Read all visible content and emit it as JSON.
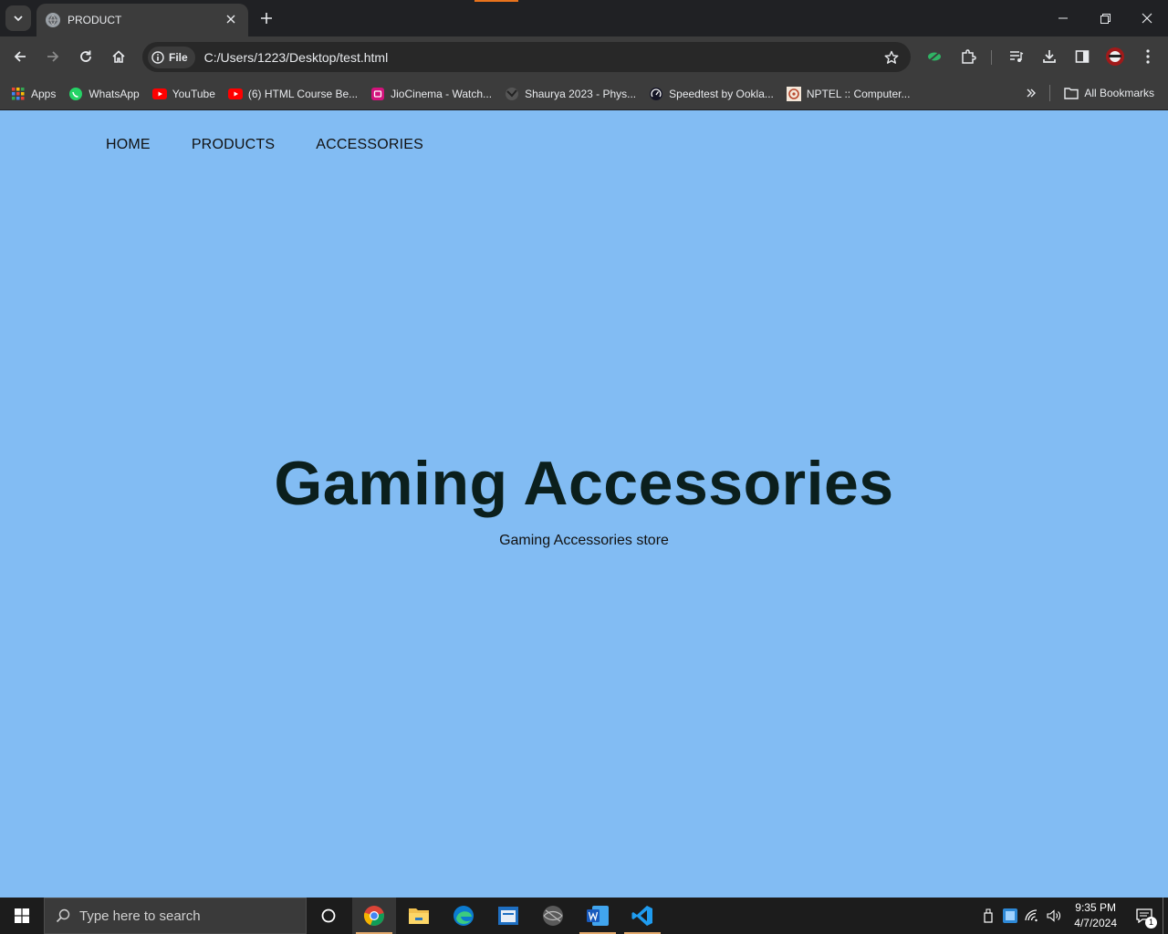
{
  "browser": {
    "tab_title": "PRODUCT",
    "site_chip_label": "File",
    "url": "C:/Users/1223/Desktop/test.html"
  },
  "bookmarks": {
    "items": [
      {
        "label": "Apps",
        "icon": "apps-grid-icon"
      },
      {
        "label": "WhatsApp",
        "icon": "whatsapp-icon"
      },
      {
        "label": "YouTube",
        "icon": "youtube-icon"
      },
      {
        "label": "(6) HTML Course Be...",
        "icon": "youtube-icon"
      },
      {
        "label": "JioCinema - Watch...",
        "icon": "jiocinema-icon"
      },
      {
        "label": "Shaurya 2023 - Phys...",
        "icon": "globe-icon"
      },
      {
        "label": "Speedtest by Ookla...",
        "icon": "speedtest-icon"
      },
      {
        "label": "NPTEL :: Computer...",
        "icon": "nptel-icon"
      }
    ],
    "all_bookmarks_label": "All Bookmarks"
  },
  "page": {
    "nav": [
      "HOME",
      "PRODUCTS",
      "ACCESSORIES"
    ],
    "hero_title": "Gaming Accessories",
    "hero_subtitle": "Gaming Accessories store",
    "background_color": "#82bcf3"
  },
  "taskbar": {
    "search_placeholder": "Type here to search",
    "time": "9:35 PM",
    "date": "4/7/2024",
    "notification_count": "1"
  }
}
